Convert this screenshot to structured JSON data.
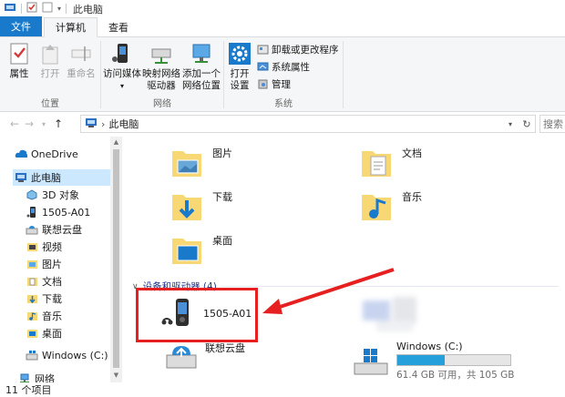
{
  "window": {
    "title": "此电脑"
  },
  "tabs": [
    {
      "label": "文件"
    },
    {
      "label": "计算机"
    },
    {
      "label": "查看"
    }
  ],
  "ribbon": {
    "groups": {
      "location": {
        "label": "位置",
        "buttons": {
          "properties": "属性",
          "open": "打开",
          "rename": "重命名"
        }
      },
      "network": {
        "label": "网络",
        "buttons": {
          "media_line1": "访问媒体",
          "map_line1": "映射网络",
          "map_line2": "驱动器",
          "add_line1": "添加一个",
          "add_line2": "网络位置"
        }
      },
      "system": {
        "label": "系统",
        "buttons": {
          "settings_line1": "打开",
          "settings_line2": "设置",
          "uninstall": "卸载或更改程序",
          "sysprops": "系统属性",
          "manage": "管理"
        }
      }
    }
  },
  "address": {
    "path": "此电脑",
    "search_placeholder": "搜索"
  },
  "navpane": {
    "items": [
      {
        "label": "OneDrive"
      },
      {
        "label": "此电脑"
      },
      {
        "label": "3D 对象"
      },
      {
        "label": "1505-A01"
      },
      {
        "label": "联想云盘"
      },
      {
        "label": "视频"
      },
      {
        "label": "图片"
      },
      {
        "label": "文档"
      },
      {
        "label": "下载"
      },
      {
        "label": "音乐"
      },
      {
        "label": "桌面"
      },
      {
        "label": "Windows (C:)"
      },
      {
        "label": "网络"
      }
    ]
  },
  "content": {
    "folders": [
      {
        "label": "图片"
      },
      {
        "label": "文档"
      },
      {
        "label": "下载"
      },
      {
        "label": "音乐"
      },
      {
        "label": "桌面"
      }
    ],
    "devices_section": {
      "label": "设备和驱动器 (4)"
    },
    "devices": [
      {
        "label": "1505-A01"
      },
      {
        "label": "联想云盘"
      },
      {
        "label": "Windows (C:)",
        "usage": "61.4 GB 可用，共 105 GB",
        "used_fraction": 0.42
      }
    ]
  },
  "status": {
    "text": "11 个项目"
  },
  "colors": {
    "accent": "#1979ca",
    "folder": "#f8d775",
    "highlight": "#e62020",
    "drive_fill": "#26a0da"
  }
}
